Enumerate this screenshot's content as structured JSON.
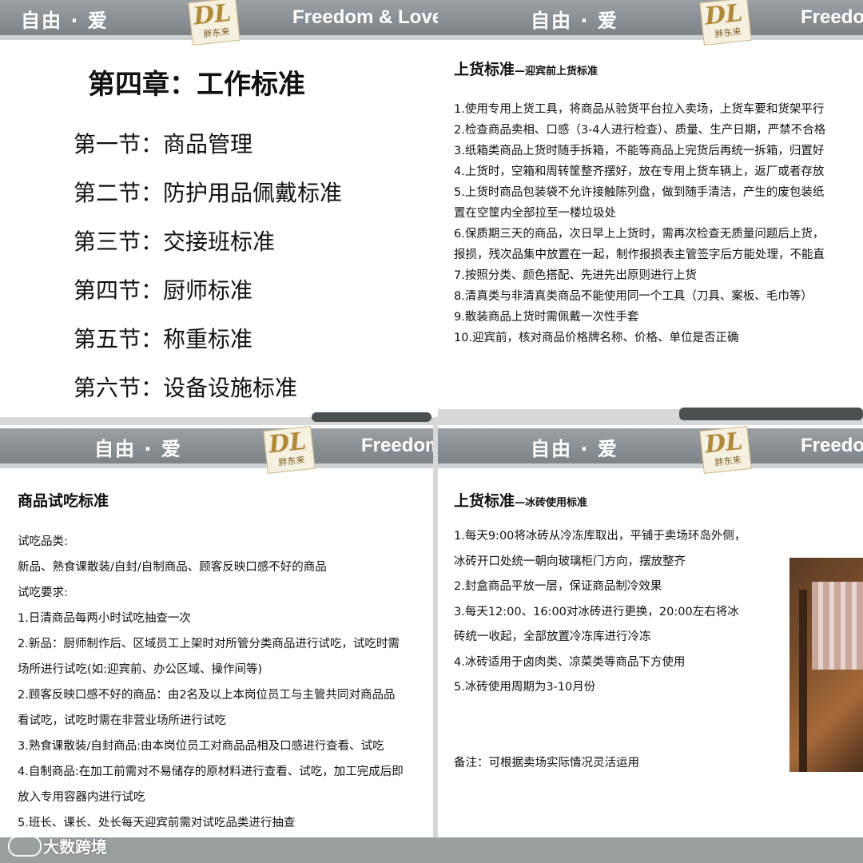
{
  "header": {
    "left_text": "自由 · 爱",
    "right_text": "Freedom & Love",
    "logo_mark": "DL",
    "logo_cn": "胖东来"
  },
  "chapter": {
    "title": "第四章：工作标准",
    "sections": [
      "第一节：商品管理",
      "第二节：防护用品佩戴标准",
      "第三节：交接班标准",
      "第四节：厨师标准",
      "第五节：称重标准",
      "第六节：设备设施标准"
    ]
  },
  "shelving": {
    "title": "上货标准",
    "subtitle": "—迎宾前上货标准",
    "items": [
      "1.使用专用上货工具，将商品从验货平台拉入卖场，上货车要和货架平行",
      "2.检查商品卖相、口感（3-4人进行检查）、质量、生产日期，严禁不合格",
      "3.纸箱类商品上货时随手拆箱，不能等商品上完货后再统一拆箱，归置好",
      "4.上货时，空箱和周转筐整齐摆好，放在专用上货车辆上，返厂或者存放",
      "5.上货时商品包装袋不允许接触陈列盘，做到随手清洁，产生的废包装纸",
      "置在空筐内全部拉至一楼垃圾处",
      "6.保质期三天的商品，次日早上上货时，需再次检查无质量问题后上货，",
      "报损，残次品集中放置在一起，制作报损表主管签字后方能处理，不能直",
      "7.按照分类、颜色搭配、先进先出原则进行上货",
      "8.清真类与非清真类商品不能使用同一个工具（刀具、案板、毛巾等）",
      "9.散装商品上货时需佩戴一次性手套",
      "10.迎宾前，核对商品价格牌名称、价格、单位是否正确"
    ]
  },
  "tasting": {
    "title": "商品试吃标准",
    "lines": [
      "试吃品类:",
      "新品、熟食课散装/自封/自制商品、顾客反映口感不好的商品",
      "试吃要求:",
      "1.日清商品每两小时试吃抽查一次",
      "2.新品：厨师制作后、区域员工上架时对所管分类商品进行试吃，试吃时需",
      "场所进行试吃(如:迎宾前、办公区域、操作间等)",
      "2.顾客反映口感不好的商品：由2名及以上本岗位员工与主管共同对商品品",
      "看试吃，试吃时需在非营业场所进行试吃",
      "3.熟食课散装/自封商品:由本岗位员工对商品品相及口感进行查看、试吃",
      "4.自制商品:在加工前需对不易储存的原材料进行查看、试吃，加工完成后即",
      "放入专用容器内进行试吃",
      "5.班长、课长、处长每天迎宾前需对试吃品类进行抽查"
    ]
  },
  "icebrick": {
    "title": "上货标准",
    "subtitle": "—冰砖使用标准",
    "lines": [
      "1.每天9:00将冰砖从冷冻库取出，平铺于卖场环岛外侧，",
      "冰砖开口处统一朝向玻璃柜门方向，摆放整齐",
      "2.封盒商品平放一层，保证商品制冷效果",
      "3.每天12:00、16:00对冰砖进行更换，20:00左右将冰",
      "砖统一收起，全部放置冷冻库进行冷冻",
      "4.冰砖适用于卤肉类、凉菜类等商品下方使用",
      "5.冰砖使用周期为3-10月份"
    ],
    "note": "备注：可根据卖场实际情况灵活运用"
  },
  "watermark": "大数跨境"
}
